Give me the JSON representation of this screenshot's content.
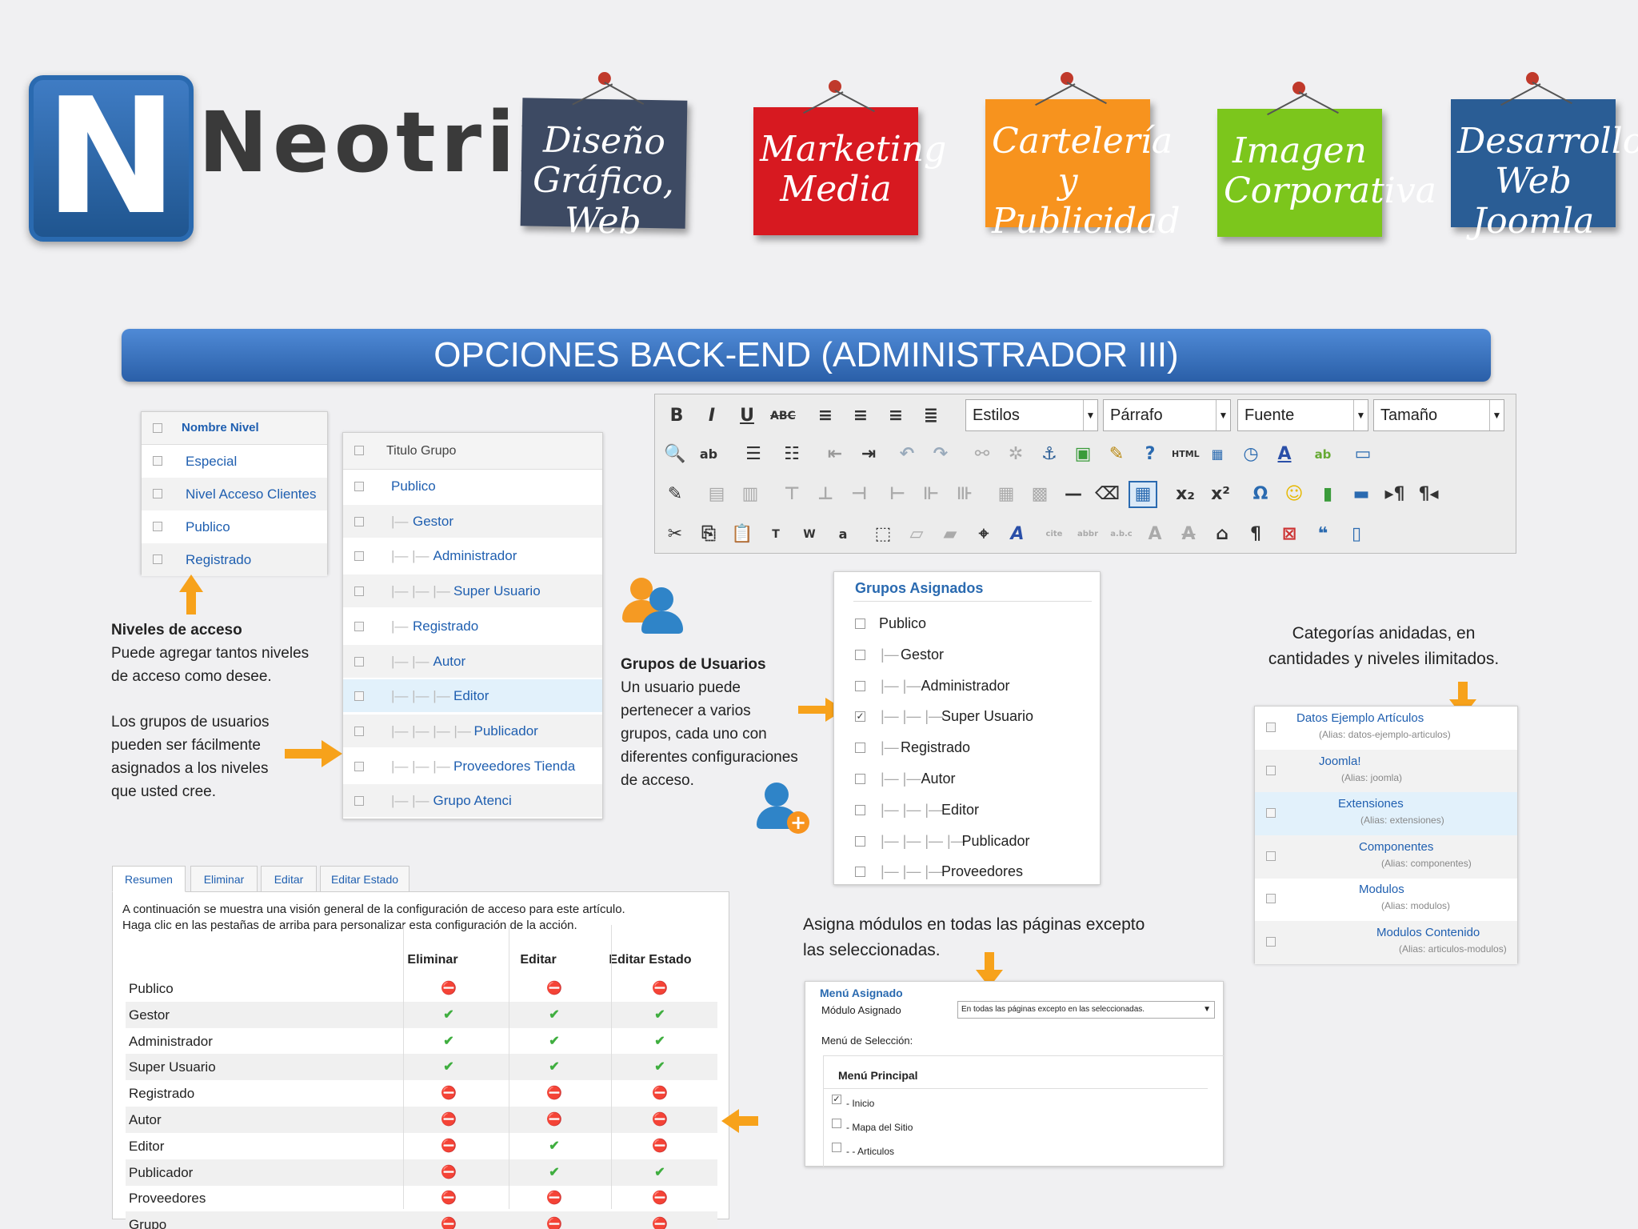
{
  "brand": {
    "logo_letter": "N",
    "name": "Neotrix",
    "accent": "#2a6ab0"
  },
  "signs": [
    {
      "text": "Diseño Gráfico, Web",
      "color": "#3d4a63"
    },
    {
      "text": "Marketing Media",
      "color": "#d71920"
    },
    {
      "text": "Cartelería y Publicidad",
      "color": "#f7931e"
    },
    {
      "text": "Imagen Corporativa",
      "color": "#7cc61c"
    },
    {
      "text": "Desarrollo Web Joomla",
      "color": "#2a5d95"
    }
  ],
  "title": "OPCIONES BACK-END (ADMINISTRADOR III)",
  "access_levels": {
    "header": "Nombre Nivel",
    "items": [
      "Especial",
      "Nivel Acceso Clientes",
      "Publico",
      "Registrado"
    ]
  },
  "groups_list": {
    "header": "Titulo Grupo",
    "items": [
      {
        "prefix": "",
        "label": "Publico"
      },
      {
        "prefix": "|—",
        "label": "Gestor"
      },
      {
        "prefix": "|— |—",
        "label": "Administrador"
      },
      {
        "prefix": "|— |— |—",
        "label": "Super Usuario"
      },
      {
        "prefix": "|—",
        "label": "Registrado"
      },
      {
        "prefix": "|— |—",
        "label": "Autor"
      },
      {
        "prefix": "|— |— |—",
        "label": "Editor"
      },
      {
        "prefix": "|— |— |— |—",
        "label": "Publicador"
      },
      {
        "prefix": "|— |— |—",
        "label": "Proveedores Tienda"
      },
      {
        "prefix": "|— |—",
        "label": "Grupo Atenci"
      }
    ]
  },
  "captions": {
    "levels_title": "Niveles de acceso",
    "levels_line1": "Puede agregar tantos niveles",
    "levels_line2": "de acceso como desee.",
    "groups_p1": "Los grupos de usuarios",
    "groups_p2": "pueden ser fácilmente",
    "groups_p3": "asignados a los niveles",
    "groups_p4": "que usted cree.",
    "users_title": "Grupos de Usuarios",
    "users_l1": "Un usuario puede",
    "users_l2": "pertenecer a varios",
    "users_l3": "grupos, cada uno con",
    "users_l4": "diferentes configuraciones",
    "users_l5": "de acceso.",
    "cat_l1": "Categorías anidadas, en",
    "cat_l2": "cantidades y niveles ilimitados.",
    "mod_l1": "Asigna módulos en todas las páginas excepto",
    "mod_l2": "las seleccionadas."
  },
  "toolbar": {
    "styles": "Estilos",
    "paragraph": "Párrafo",
    "font": "Fuente",
    "size": "Tamaño",
    "html_label": "HTML"
  },
  "assigned_groups": {
    "header": "Grupos Asignados",
    "items": [
      {
        "prefix": "",
        "label": "Publico",
        "checked": false
      },
      {
        "prefix": "|—",
        "label": "Gestor",
        "checked": false
      },
      {
        "prefix": "|— |—",
        "label": "Administrador",
        "checked": false
      },
      {
        "prefix": "|— |— |—",
        "label": "Super Usuario",
        "checked": true
      },
      {
        "prefix": "|—",
        "label": "Registrado",
        "checked": false
      },
      {
        "prefix": "|— |—",
        "label": "Autor",
        "checked": false
      },
      {
        "prefix": "|— |— |—",
        "label": "Editor",
        "checked": false
      },
      {
        "prefix": "|— |— |— |—",
        "label": "Publicador",
        "checked": false
      },
      {
        "prefix": "|— |— |—",
        "label": "Proveedores",
        "checked": false
      }
    ]
  },
  "categories": [
    {
      "label": "Datos Ejemplo Artículos",
      "alias": "(Alias: datos-ejemplo-articulos)"
    },
    {
      "label": "Joomla!",
      "alias": "(Alias: joomla)"
    },
    {
      "label": "Extensiones",
      "alias": "(Alias: extensiones)"
    },
    {
      "label": "Componentes",
      "alias": "(Alias: componentes)"
    },
    {
      "label": "Modulos",
      "alias": "(Alias: modulos)"
    },
    {
      "label": "Modulos Contenido",
      "alias": "(Alias: articulos-modulos)"
    }
  ],
  "permissions": {
    "tabs": [
      "Resumen",
      "Eliminar",
      "Editar",
      "Editar Estado"
    ],
    "intro1": "A continuación se muestra una visión general de la configuración de acceso para este artículo.",
    "intro2": "Haga clic en las pestañas de arriba para personalizar esta configuración de la acción.",
    "columns": [
      "Eliminar",
      "Editar",
      "Editar Estado"
    ],
    "rows": [
      {
        "name": "Publico",
        "values": [
          "deny",
          "deny",
          "deny"
        ]
      },
      {
        "name": "Gestor",
        "values": [
          "ok",
          "ok",
          "ok"
        ]
      },
      {
        "name": "Administrador",
        "values": [
          "ok",
          "ok",
          "ok"
        ]
      },
      {
        "name": "Super Usuario",
        "values": [
          "ok",
          "ok",
          "ok"
        ]
      },
      {
        "name": "Registrado",
        "values": [
          "deny",
          "deny",
          "deny"
        ]
      },
      {
        "name": "Autor",
        "values": [
          "deny",
          "deny",
          "deny"
        ]
      },
      {
        "name": "Editor",
        "values": [
          "deny",
          "ok",
          "deny"
        ]
      },
      {
        "name": "Publicador",
        "values": [
          "deny",
          "ok",
          "ok"
        ]
      },
      {
        "name": "Proveedores",
        "values": [
          "deny",
          "deny",
          "deny"
        ]
      },
      {
        "name": "Grupo",
        "values": [
          "deny",
          "deny",
          "deny"
        ]
      }
    ]
  },
  "menu_assignment": {
    "header": "Menú Asignado",
    "field_label": "Módulo Asignado",
    "field_value": "En todas las páginas excepto en las seleccionadas.",
    "selection_label": "Menú de Selección:",
    "menu_title": "Menú Principal",
    "items": [
      {
        "label": "- Inicio",
        "checked": true
      },
      {
        "label": "- Mapa del Sitio",
        "checked": false
      },
      {
        "label": "- - Articulos",
        "checked": false
      }
    ]
  }
}
